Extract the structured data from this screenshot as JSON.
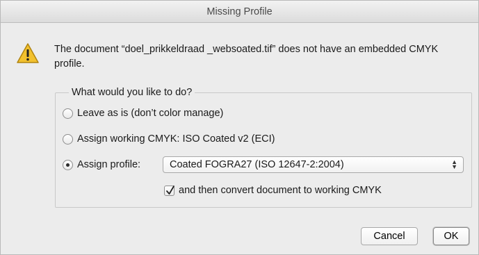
{
  "window": {
    "title": "Missing Profile"
  },
  "message": "The document “doel_prikkeldraad _websoated.tif” does not have an embedded CMYK profile.",
  "group": {
    "legend": "What would you like to do?",
    "options": [
      {
        "label": "Leave as is (don’t color manage)",
        "selected": false
      },
      {
        "label": "Assign working CMYK:  ISO Coated v2 (ECI)",
        "selected": false
      },
      {
        "label": "Assign profile:",
        "selected": true
      }
    ],
    "profile_select": {
      "value": "Coated FOGRA27 (ISO 12647-2:2004)"
    },
    "convert_checkbox": {
      "label": "and then convert document to working CMYK",
      "checked": true
    }
  },
  "buttons": {
    "cancel": "Cancel",
    "ok": "OK"
  },
  "icons": {
    "warning": "warning-icon",
    "select_arrows": "updown-arrows-icon",
    "check": "checkmark-icon"
  },
  "colors": {
    "warning_fill": "#f2c12e",
    "warning_stroke": "#b08410"
  }
}
